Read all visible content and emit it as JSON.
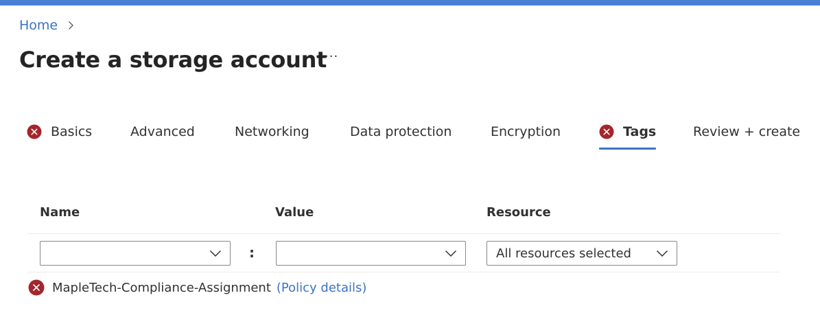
{
  "breadcrumb": {
    "home": "Home"
  },
  "header": {
    "title": "Create a storage account",
    "more": "···"
  },
  "tabs": [
    {
      "label": "Basics",
      "error": true,
      "active": false
    },
    {
      "label": "Advanced",
      "error": false,
      "active": false
    },
    {
      "label": "Networking",
      "error": false,
      "active": false
    },
    {
      "label": "Data protection",
      "error": false,
      "active": false
    },
    {
      "label": "Encryption",
      "error": false,
      "active": false
    },
    {
      "label": "Tags",
      "error": true,
      "active": true
    },
    {
      "label": "Review + create",
      "error": false,
      "active": false
    }
  ],
  "table": {
    "headers": {
      "name": "Name",
      "value": "Value",
      "resource": "Resource"
    },
    "row": {
      "name": "",
      "separator": ":",
      "value": "",
      "resource": "All resources selected"
    }
  },
  "policy": {
    "name": "MapleTech-Compliance-Assignment",
    "link": "(Policy details)"
  },
  "colors": {
    "accent": "#3b73c4",
    "error": "#a4262c",
    "topbar": "#4a7fd4"
  },
  "icons": {
    "error": "error-circle-icon",
    "chevron": "chevron-right-icon",
    "caret": "chevron-down-icon"
  }
}
